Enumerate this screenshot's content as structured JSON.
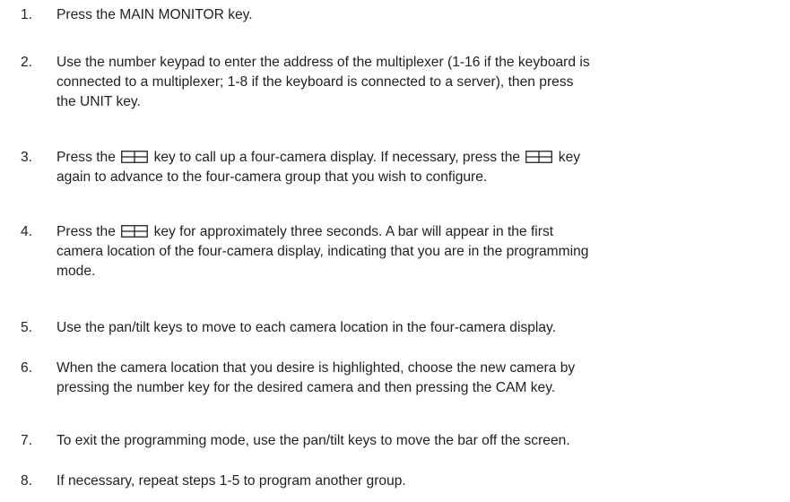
{
  "steps": [
    {
      "number": "1.",
      "text": "Press the MAIN MONITOR key."
    },
    {
      "number": "2.",
      "line1": "Use the number keypad to enter the address of the multiplexer (1-16 if the keyboard is",
      "line2": "connected to a multiplexer; 1-8 if the keyboard is connected to a server), then press",
      "line3": "the UNIT key."
    },
    {
      "number": "3.",
      "part1": "Press the",
      "part2": "key to call up a four-camera display. If necessary, press the",
      "part3": "key",
      "line2": "again to advance to the four-camera group that you wish to configure."
    },
    {
      "number": "4.",
      "part1": "Press the",
      "part2": "key for approximately three seconds. A bar will appear in the first",
      "line2": "camera location of the four-camera display, indicating that you are in the programming",
      "line3": "mode."
    },
    {
      "number": "5.",
      "text": "Use the pan/tilt keys to move to each camera location in the four-camera display."
    },
    {
      "number": "6.",
      "line1": "When the camera location that you desire is highlighted, choose the new camera by",
      "line2": "pressing the number key for the desired camera and then pressing the CAM key."
    },
    {
      "number": "7.",
      "text": "To exit the programming mode, use the pan/tilt keys to move the bar off the screen."
    },
    {
      "number": "8.",
      "text": "If necessary, repeat steps 1-5 to program another group."
    }
  ],
  "icons": {
    "quad_key": "quad-split-icon"
  }
}
